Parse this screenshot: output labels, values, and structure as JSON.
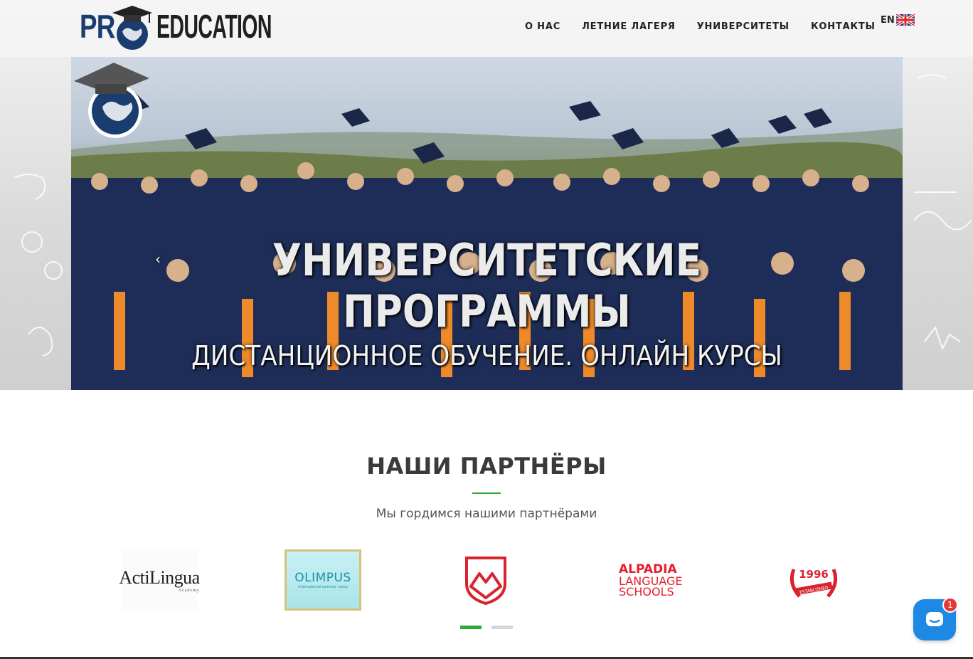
{
  "header": {
    "logo": {
      "text_left": "PR",
      "text_right": "EDUCATION",
      "icon": "graduation-cap-globe-icon"
    },
    "nav": [
      {
        "label": "О НАС"
      },
      {
        "label": "ЛЕТНИЕ ЛАГЕРЯ"
      },
      {
        "label": "УНИВЕРСИТЕТЫ"
      },
      {
        "label": "КОНТАКТЫ"
      }
    ],
    "language": {
      "label": "EN",
      "icon": "uk-flag-icon"
    }
  },
  "hero": {
    "title": "УНИВЕРСИТЕТСКИЕ ПРОГРАММЫ",
    "subtitle": "ДИСТАНЦИОННОЕ ОБУЧЕНИЕ. ОНЛАЙН КУРСЫ",
    "prev_icon": "chevron-left-icon",
    "next_icon": "chevron-right-icon"
  },
  "partners": {
    "title": "НАШИ ПАРТНЁРЫ",
    "subtitle": "Мы гордимся нашими партнёрами",
    "logos": [
      {
        "text": "ActiLingua",
        "subtext": "Academy"
      },
      {
        "text": "OLIMPUS",
        "subtext": "international summer camp"
      },
      {
        "text": "",
        "icon": "mountain-shield-logo-icon"
      },
      {
        "text": "ALPADIA",
        "subtext": "LANGUAGE SCHOOLS"
      },
      {
        "text": "1996",
        "subtext": "ESTABLISHED"
      }
    ],
    "pagination": {
      "count": 2,
      "active": 0
    }
  },
  "chat_widget": {
    "badge": "1",
    "icon": "chat-bubble-icon"
  },
  "colors": {
    "accent_green": "#2ea836",
    "logo_blue": "#1a3c6e",
    "alpadia_red": "#e41e2b",
    "chat_blue": "#1e88e5"
  }
}
